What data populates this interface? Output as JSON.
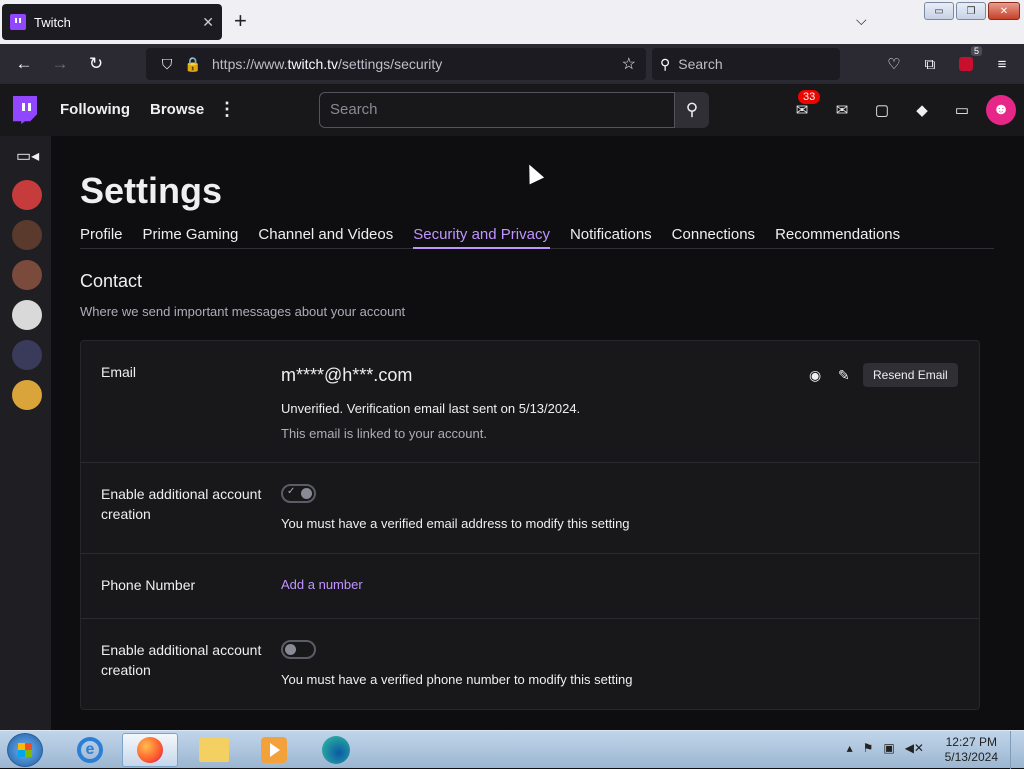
{
  "browser": {
    "tab_title": "Twitch",
    "tab_close": "✕",
    "new_tab": "+",
    "tabs_dropdown": "⌵",
    "url_prefix": "https://www.",
    "url_domain": "twitch.tv",
    "url_path": "/settings/security",
    "search_placeholder": "Search",
    "extension_badge": "5",
    "window_buttons": {
      "minimize": "▭",
      "restore": "❐",
      "close": "✕"
    },
    "icons": {
      "back": "←",
      "forward": "→",
      "reload": "↻",
      "shield": "⛉",
      "lock": "🔒",
      "star": "☆",
      "search": "⚲",
      "pocket": "♡",
      "extensions": "⧉",
      "menu": "≡"
    }
  },
  "twitch_header": {
    "nav": [
      "Following",
      "Browse"
    ],
    "more": "⋮",
    "search_placeholder": "Search",
    "search_icon": "⚲",
    "notif_count": "33",
    "icons": {
      "inbox": "✉",
      "whispers": "▢",
      "prime": "◆",
      "bits": "▭",
      "avatar": "☻",
      "notifications": "✉"
    }
  },
  "sidebar": {
    "camera_icon": "▭◂",
    "avatar_colors": [
      "#c63b3b",
      "#5a3a2c",
      "#7a4a3c",
      "#d9d9d9",
      "#3a3a5a",
      "#d9a53a"
    ]
  },
  "settings": {
    "title": "Settings",
    "tabs": [
      "Profile",
      "Prime Gaming",
      "Channel and Videos",
      "Security and Privacy",
      "Notifications",
      "Connections",
      "Recommendations"
    ],
    "active_tab": "Security and Privacy",
    "section_title": "Contact",
    "section_subtitle": "Where we send important messages about your account",
    "email": {
      "label": "Email",
      "value": "m****@h***.com",
      "show_icon": "◉",
      "edit_icon": "✎",
      "resend_button": "Resend Email",
      "status": "Unverified. Verification email last sent on 5/13/2024.",
      "linked_note": "This email is linked to your account."
    },
    "email_account_creation": {
      "label": "Enable additional account creation",
      "enabled": true,
      "check": "✓",
      "note": "You must have a verified email address to modify this setting"
    },
    "phone": {
      "label": "Phone Number",
      "action": "Add a number"
    },
    "phone_account_creation": {
      "label": "Enable additional account creation",
      "enabled": false,
      "note": "You must have a verified phone number to modify this setting"
    }
  },
  "taskbar": {
    "ie_letter": "e",
    "tray": {
      "arrow": "▴",
      "flag": "⚑",
      "network": "▣",
      "volume": "◀✕"
    },
    "time": "12:27 PM",
    "date": "5/13/2024"
  },
  "colors": {
    "twitch_purple": "#9146ff",
    "active_tab": "#bf94ff",
    "link": "#bf94ff",
    "badge_red": "#eb0400",
    "avatar_pink": "#e62787"
  }
}
